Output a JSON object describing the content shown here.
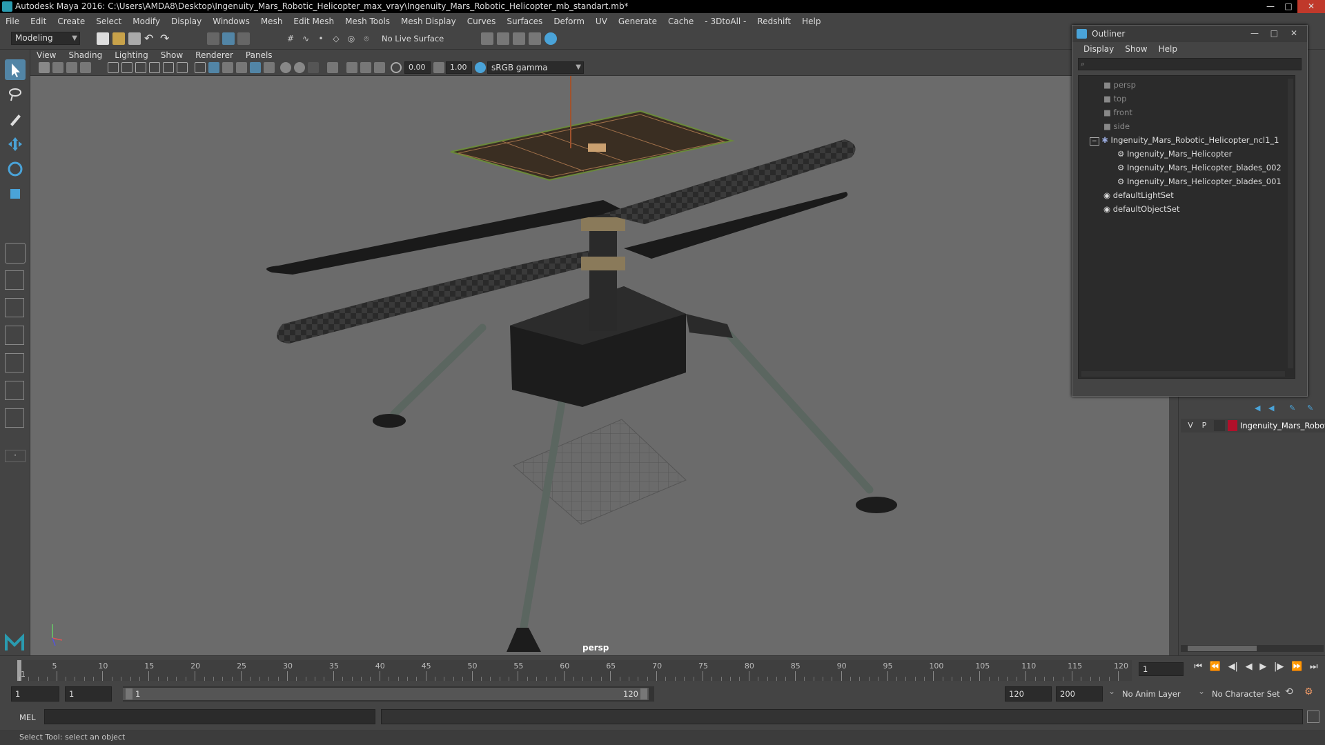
{
  "window": {
    "title": "Autodesk Maya 2016: C:\\Users\\AMDA8\\Desktop\\Ingenuity_Mars_Robotic_Helicopter_max_vray\\Ingenuity_Mars_Robotic_Helicopter_mb_standart.mb*",
    "minimize": "—",
    "maximize": "□",
    "close": "✕"
  },
  "menubar": [
    "File",
    "Edit",
    "Create",
    "Select",
    "Modify",
    "Display",
    "Windows",
    "Mesh",
    "Edit Mesh",
    "Mesh Tools",
    "Mesh Display",
    "Curves",
    "Surfaces",
    "Deform",
    "UV",
    "Generate",
    "Cache",
    "- 3DtoAll -",
    "Redshift",
    "Help"
  ],
  "statusline": {
    "mode": "Modeling",
    "live_surface": "No Live Surface"
  },
  "viewport": {
    "menus": [
      "View",
      "Shading",
      "Lighting",
      "Show",
      "Renderer",
      "Panels"
    ],
    "exposure": "0.00",
    "gamma": "1.00",
    "color_space": "sRGB gamma",
    "camera_label": "persp"
  },
  "outliner": {
    "title": "Outliner",
    "menus": [
      "Display",
      "Show",
      "Help"
    ],
    "items": [
      {
        "label": "persp",
        "dim": true
      },
      {
        "label": "top",
        "dim": true
      },
      {
        "label": "front",
        "dim": true
      },
      {
        "label": "side",
        "dim": true
      },
      {
        "label": "Ingenuity_Mars_Robotic_Helicopter_ncl1_1",
        "dim": false
      },
      {
        "label": "Ingenuity_Mars_Helicopter",
        "dim": false
      },
      {
        "label": "Ingenuity_Mars_Helicopter_blades_002",
        "dim": false
      },
      {
        "label": "Ingenuity_Mars_Helicopter_blades_001",
        "dim": false
      },
      {
        "label": "defaultLightSet",
        "dim": false
      },
      {
        "label": "defaultObjectSet",
        "dim": false
      }
    ]
  },
  "layers": {
    "visible_flag": "V",
    "playback_flag": "P",
    "layer_name": "Ingenuity_Mars_Robot",
    "layer_color": "#b0102a"
  },
  "timeline": {
    "ticks": [
      "5",
      "10",
      "15",
      "20",
      "25",
      "30",
      "35",
      "40",
      "45",
      "50",
      "55",
      "60",
      "65",
      "70",
      "75",
      "80",
      "85",
      "90",
      "95",
      "100",
      "105",
      "110",
      "115",
      "120"
    ],
    "current_frame": "1",
    "ruler_start_marker": "1"
  },
  "range": {
    "start_frame": "1",
    "playback_start": "1",
    "slider_start": "1",
    "slider_end": "120",
    "playback_end": "120",
    "end_frame": "200",
    "anim_layer": "No Anim Layer",
    "character_set": "No Character Set"
  },
  "commandline": {
    "language": "MEL"
  },
  "helpline": {
    "text": "Select Tool: select an object"
  },
  "colors": {
    "accent": "#5285a6",
    "layer_color": "#b0102a"
  }
}
